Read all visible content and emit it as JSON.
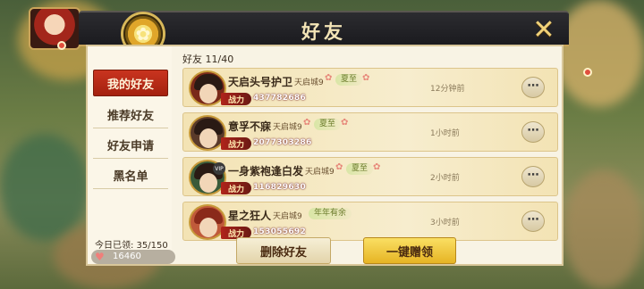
{
  "header": {
    "title": "好友",
    "emblem_icon": "flower-icon",
    "close_icon": "close-icon"
  },
  "tabs": [
    {
      "label": "我的好友",
      "active": true
    },
    {
      "label": "推荐好友",
      "active": false
    },
    {
      "label": "好友申请",
      "active": false
    },
    {
      "label": "黑名单",
      "active": false
    }
  ],
  "friends_count": "好友 11/40",
  "friends": [
    {
      "name": "天启头号护卫",
      "server": "天启城9",
      "tag": "夏至",
      "id": "437782686",
      "level": "战力",
      "last_online": "12分钟前"
    },
    {
      "name": "意孚不寐",
      "server": "天启城9",
      "tag": "夏至",
      "id": "2077303286",
      "level": "战力",
      "last_online": "1小时前"
    },
    {
      "name": "一身紫袍逢白发",
      "server": "天启城9",
      "tag": "夏至",
      "id": "116829630",
      "level": "战力",
      "last_online": "2小时前"
    },
    {
      "name": "星之狂人",
      "server": "天启城9",
      "tag": "年年有余",
      "id": "153055692",
      "level": "战力",
      "last_online": "3小时前"
    }
  ],
  "received_today": "今日已领: 35/150",
  "hearts": {
    "icon": "heart-icon",
    "value": "16460"
  },
  "buttons": {
    "delete": "删除好友",
    "claim_all": "一键赠领"
  },
  "colors": {
    "active_tab": "#b82a17",
    "claim_button": "#f0c53a",
    "panel": "#f8f3e4"
  }
}
